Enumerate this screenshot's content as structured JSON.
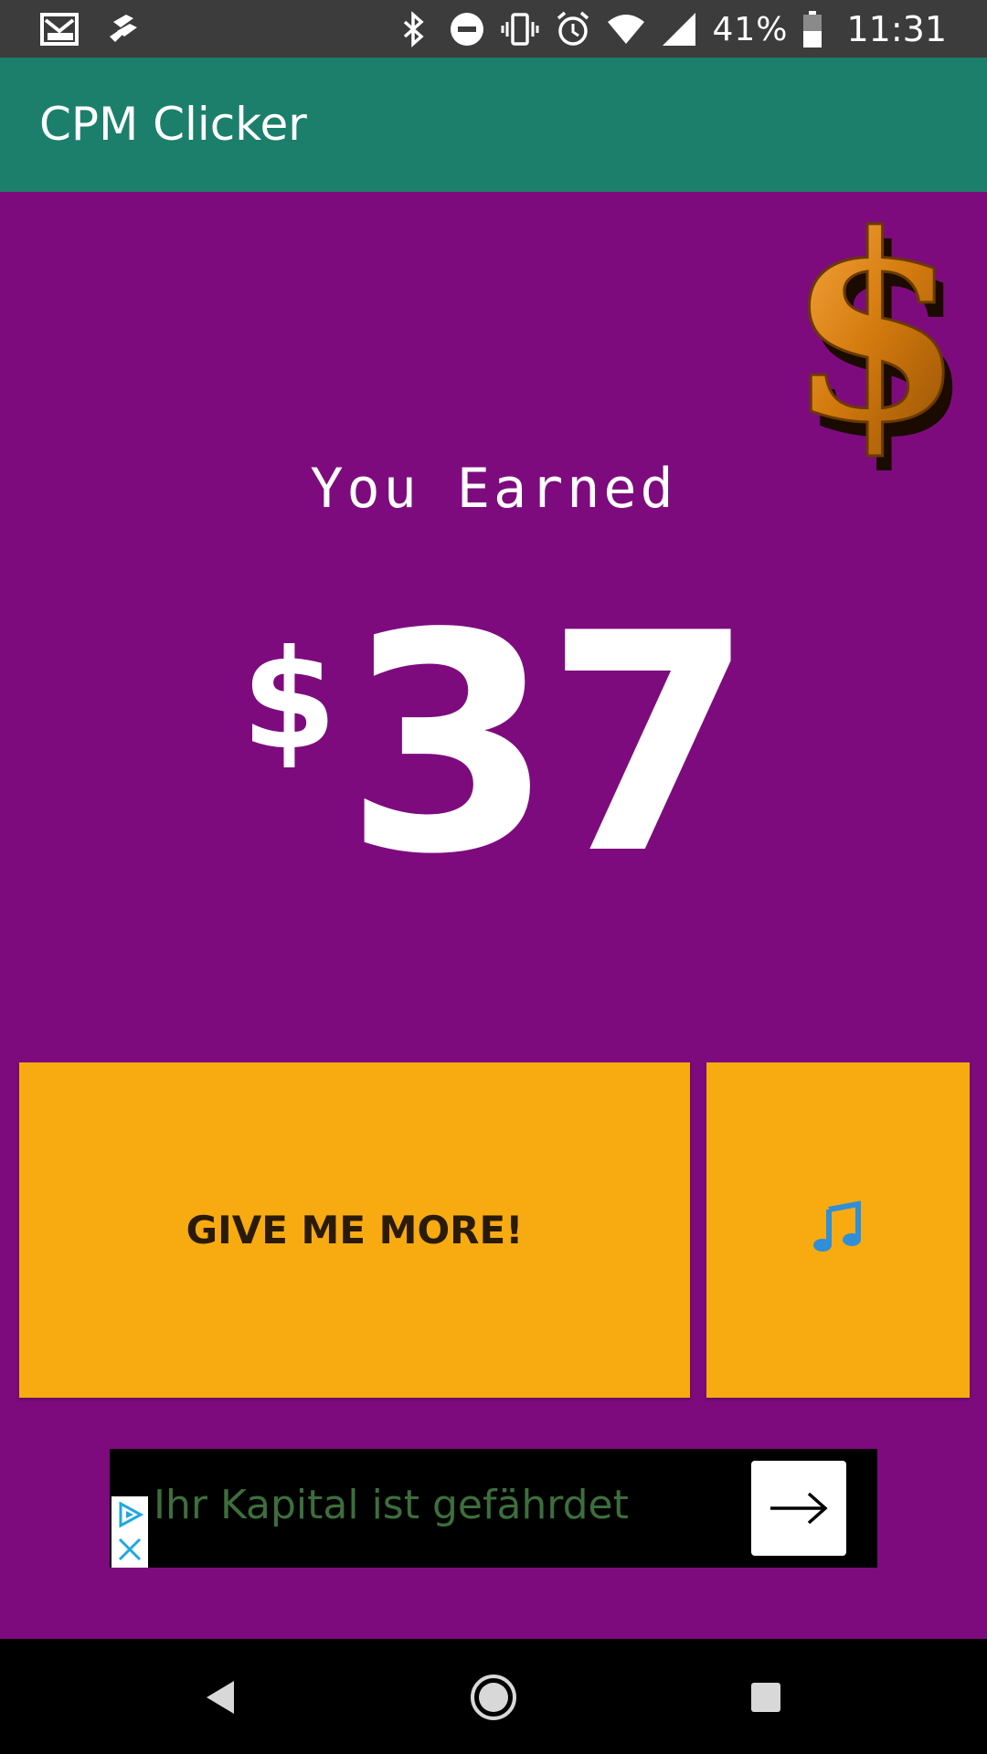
{
  "status_bar": {
    "battery_percent": "41%",
    "time": "11:31",
    "left_icons": [
      "gmail-icon",
      "jira-icon"
    ],
    "right_icons": [
      "bluetooth-icon",
      "do-not-disturb-icon",
      "vibrate-icon",
      "alarm-icon",
      "wifi-icon",
      "cell-signal-icon",
      "battery-icon"
    ]
  },
  "app_bar": {
    "title": "CPM Clicker"
  },
  "main": {
    "earned_label": "You Earned",
    "currency_symbol": "$",
    "amount": "37",
    "dollar_image_icon": "gold-dollar-sign-icon"
  },
  "buttons": {
    "give_more_label": "GIVE ME MORE!",
    "music_icon": "music-note-icon"
  },
  "ad": {
    "text": "Ihr Kapital ist gefährdet",
    "info_icon": "ad-choices-icon",
    "close_icon": "close-icon",
    "cta_icon": "arrow-right-icon"
  },
  "nav_bar": {
    "icons": [
      "back-icon",
      "home-icon",
      "recents-icon"
    ]
  },
  "colors": {
    "background": "#7d0b7e",
    "app_bar": "#1b7f6b",
    "status_bar": "#3c3c3c",
    "button": "#f7ab10",
    "ad_text": "#3d6e3d"
  }
}
